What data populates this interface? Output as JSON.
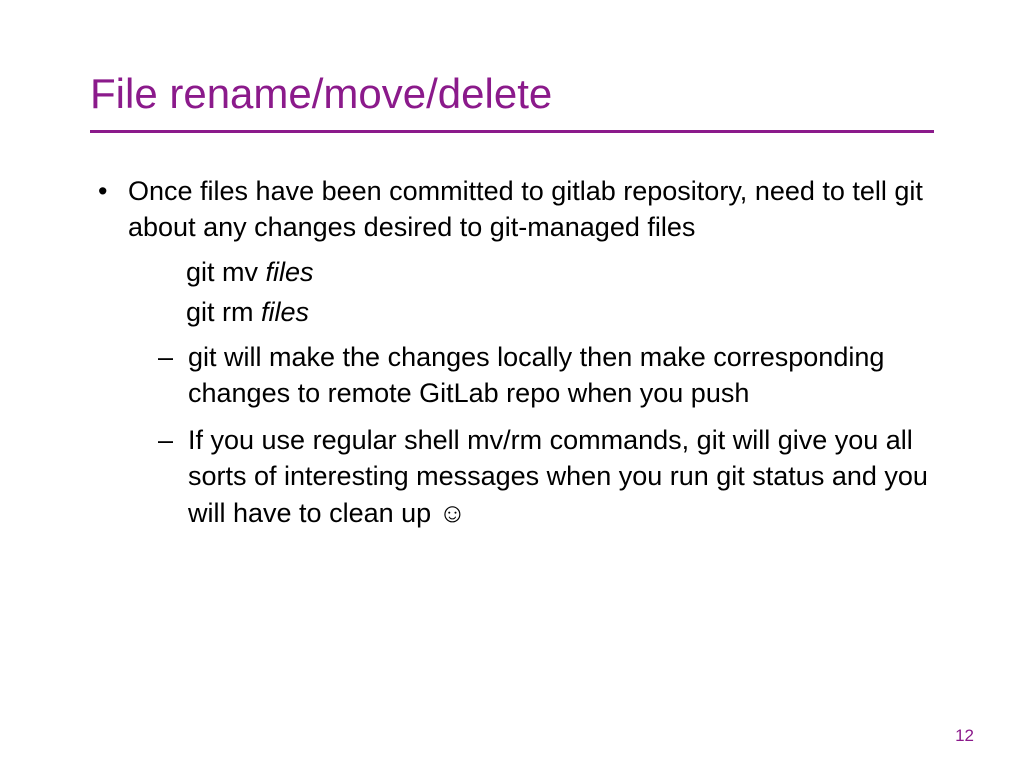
{
  "title": "File rename/move/delete",
  "bullets": {
    "main": "Once files have been committed to gitlab repository, need to tell git about any changes desired to git-managed files",
    "cmd1_prefix": "git mv ",
    "cmd1_italic": "files",
    "cmd2_prefix": "git rm ",
    "cmd2_italic": "files",
    "sub1": "git will make the changes locally then make corresponding changes to remote GitLab repo when you push",
    "sub2_text": "If you use regular shell mv/rm commands, git will give you all sorts of interesting messages when you run git status and you will have to clean up ",
    "sub2_emoji": "☺"
  },
  "page_number": "12"
}
